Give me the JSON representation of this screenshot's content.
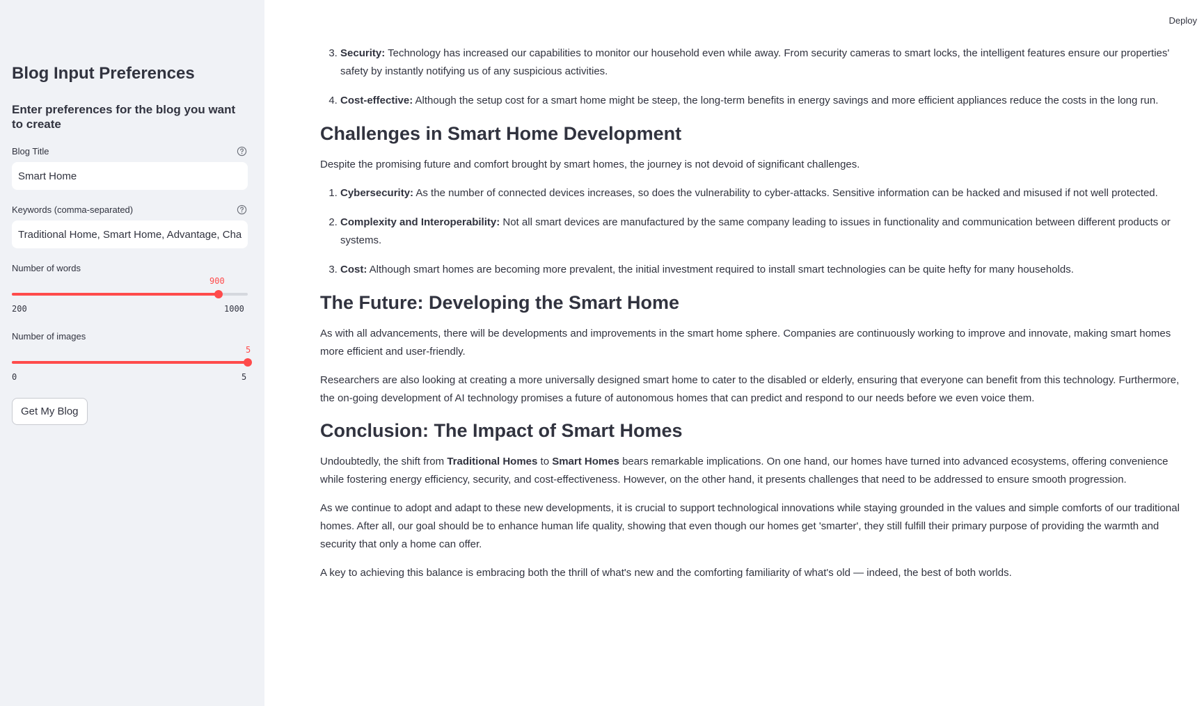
{
  "sidebar": {
    "title": "Blog Input Preferences",
    "subtitle": "Enter preferences for the blog you want to create",
    "blog_title": {
      "label": "Blog Title",
      "value": "Smart Home",
      "help_icon": "question-circle-icon"
    },
    "keywords": {
      "label": "Keywords (comma-separated)",
      "value": "Traditional Home, Smart Home, Advantage, Chal",
      "help_icon": "question-circle-icon"
    },
    "words_slider": {
      "label": "Number of words",
      "value": "900",
      "min": "200",
      "max": "1000",
      "fraction": 0.875
    },
    "images_slider": {
      "label": "Number of images",
      "value": "5",
      "min": "0",
      "max": "5",
      "fraction": 1.0
    },
    "button_label": "Get My Blog"
  },
  "header": {
    "deploy_label": "Deploy"
  },
  "content": {
    "list1": [
      {
        "num": "3.",
        "bold": "Security:",
        "text": " Technology has increased our capabilities to monitor our household even while away. From security cameras to smart locks, the intelligent features ensure our properties' safety by instantly notifying us of any suspicious activities."
      },
      {
        "num": "4.",
        "bold": "Cost-effective:",
        "text": " Although the setup cost for a smart home might be steep, the long-term benefits in energy savings and more efficient appliances reduce the costs in the long run."
      }
    ],
    "h_challenges": "Challenges in Smart Home Development",
    "p_challenges": "Despite the promising future and comfort brought by smart homes, the journey is not devoid of significant challenges.",
    "list2": [
      {
        "num": "1.",
        "bold": "Cybersecurity:",
        "text": " As the number of connected devices increases, so does the vulnerability to cyber-attacks. Sensitive information can be hacked and misused if not well protected."
      },
      {
        "num": "2.",
        "bold": "Complexity and Interoperability:",
        "text": " Not all smart devices are manufactured by the same company leading to issues in functionality and communication between different products or systems."
      },
      {
        "num": "3.",
        "bold": "Cost:",
        "text": " Although smart homes are becoming more prevalent, the initial investment required to install smart technologies can be quite hefty for many households."
      }
    ],
    "h_future": "The Future: Developing the Smart Home",
    "p_future1": "As with all advancements, there will be developments and improvements in the smart home sphere. Companies are continuously working to improve and innovate, making smart homes more efficient and user-friendly.",
    "p_future2": "Researchers are also looking at creating a more universally designed smart home to cater to the disabled or elderly, ensuring that everyone can benefit from this technology. Furthermore, the on-going development of AI technology promises a future of autonomous homes that can predict and respond to our needs before we even voice them.",
    "h_conclusion": "Conclusion: The Impact of Smart Homes",
    "p_concl1": {
      "pre": "Undoubtedly, the shift from ",
      "b1": "Traditional Homes",
      "mid": " to ",
      "b2": "Smart Homes",
      "post": " bears remarkable implications. On one hand, our homes have turned into advanced ecosystems, offering convenience while fostering energy efficiency, security, and cost-effectiveness. However, on the other hand, it presents challenges that need to be addressed to ensure smooth progression."
    },
    "p_concl2": "As we continue to adopt and adapt to these new developments, it is crucial to support technological innovations while staying grounded in the values and simple comforts of our traditional homes. After all, our goal should be to enhance human life quality, showing that even though our homes get 'smarter', they still fulfill their primary purpose of providing the warmth and security that only a home can offer.",
    "p_concl3": "A key to achieving this balance is embracing both the thrill of what's new and the comforting familiarity of what's old — indeed, the best of both worlds."
  }
}
